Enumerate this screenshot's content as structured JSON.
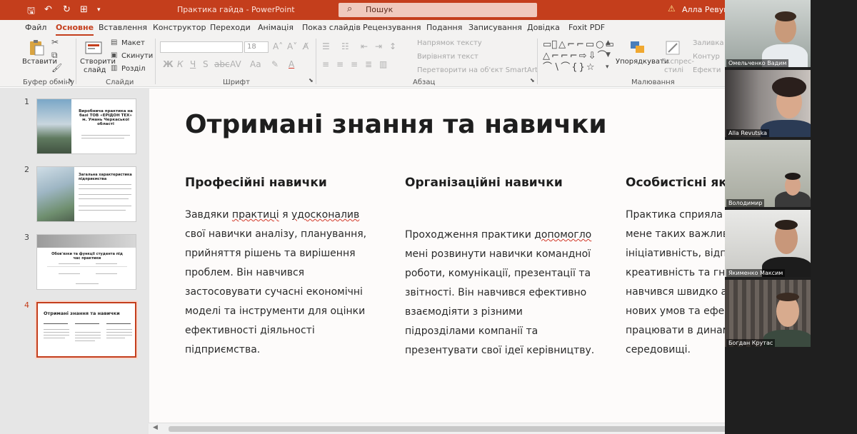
{
  "titlebar": {
    "title": "Практика гайда  -  PowerPoint",
    "search_placeholder": "Пошук",
    "user": "Алла Ревуцька",
    "accent": "#c43e1c"
  },
  "tabs": [
    "Файл",
    "Основне",
    "Вставлення",
    "Конструктор",
    "Переходи",
    "Анімація",
    "Показ слайдів",
    "Рецензування",
    "Подання",
    "Записування",
    "Довідка",
    "Foxit PDF"
  ],
  "active_tab": "Основне",
  "ribbon": {
    "clipboard": {
      "paste": "Вставити",
      "label": "Буфер обміну"
    },
    "slides": {
      "new_slide": "Створити",
      "new_slide2": "слайд",
      "layout": "Макет",
      "reset": "Скинути",
      "section": "Розділ",
      "label": "Слайди"
    },
    "font": {
      "size": "18",
      "label": "Шрифт"
    },
    "paragraph": {
      "text_direction": "Напрямок тексту",
      "align_text": "Вирівняти текст",
      "smartart": "Перетворити на об'єкт SmartArt",
      "label": "Абзац"
    },
    "drawing": {
      "arrange": "Упорядкувати",
      "quick_styles": "Експрес-",
      "quick_styles2": "стилі",
      "fill": "Заливка",
      "outline": "Контур",
      "effects": "Ефекти",
      "label": "Малювання"
    }
  },
  "thumbnails": [
    {
      "num": "1",
      "title": "Виробнича практика на базі ТОВ «ЕРІДОН ТЕХ» м. Умань Черкаської області"
    },
    {
      "num": "2",
      "title": "Загальна характеристика підприємства"
    },
    {
      "num": "3",
      "title": "Обов'язки та функції студента під час практики"
    },
    {
      "num": "4",
      "title": "Отримані знання та навички"
    }
  ],
  "slide": {
    "title": "Отримані знання та навички",
    "columns": [
      {
        "heading": "Професійні навички",
        "lines": [
          "Завдяки практиці я удосконалив",
          "свої навички аналізу, планування,",
          "прийняття рішень та вирішення",
          "проблем. Він навчився",
          "застосовувати сучасні економічні",
          "моделі та інструменти для оцінки",
          "ефективності діяльності",
          "підприємства."
        ]
      },
      {
        "heading": "Організаційні навички",
        "lines": [
          "Проходження практики допомогло",
          "мені розвинути навички командної",
          "роботи, комунікації, презентації та",
          "звітності. Він навчився ефективно",
          "взаємодіяти з різними",
          "підрозділами компанії та",
          "презентувати свої ідеї керівництву."
        ]
      },
      {
        "heading": "Особистісні як",
        "lines": [
          "Практика сприяла ф",
          "мене таких важливи",
          "ініціативність, відпо",
          "креативність та гнуч",
          "навчився швидко ад",
          "нових умов та ефек",
          "працювати в динам",
          "середовищі."
        ]
      }
    ]
  },
  "participants": [
    "Омельченко Вадим",
    "Alla Revutska",
    "Володимир",
    "Якименко Максим",
    "Богдан Крутас"
  ]
}
